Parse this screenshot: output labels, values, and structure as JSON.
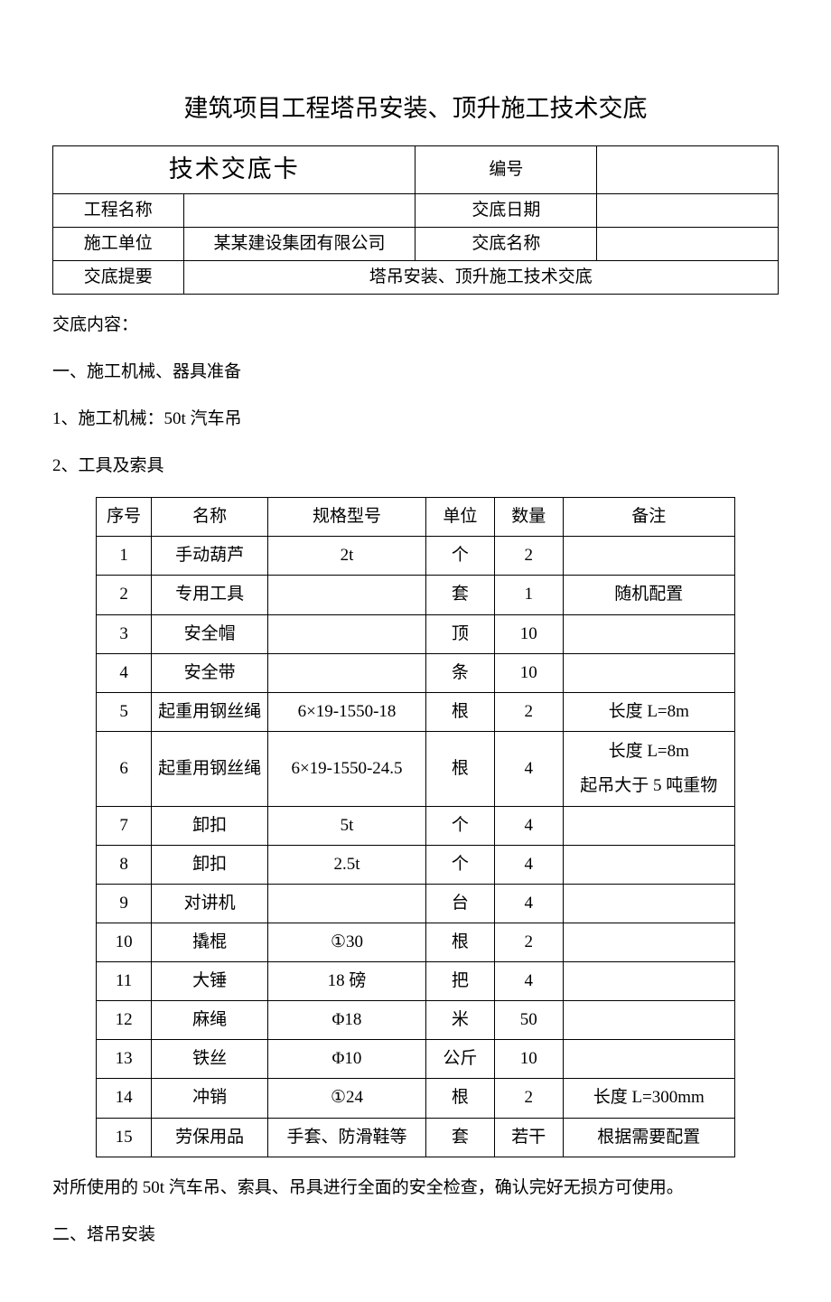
{
  "title": "建筑项目工程塔吊安装、顶升施工技术交底",
  "info": {
    "card_title": "技术交底卡",
    "bianhao_label": "编号",
    "bianhao_value": "",
    "project_name_label": "工程名称",
    "project_name_value": "",
    "date_label": "交底日期",
    "date_value": "",
    "unit_label": "施工单位",
    "unit_value": "某某建设集团有限公司",
    "topic_name_label": "交底名称",
    "topic_name_value": "",
    "summary_label": "交底提要",
    "summary_value": "塔吊安装、顶升施工技术交底"
  },
  "body": {
    "content_label": "交底内容：",
    "s1_title": "一、施工机械、器具准备",
    "s1_1": "1、施工机械：50t 汽车吊",
    "s1_2": "2、工具及索具",
    "after_table": "对所使用的 50t 汽车吊、索具、吊具进行全面的安全检查，确认完好无损方可使用。",
    "s2_title": "二、塔吊安装"
  },
  "tools_header": {
    "idx": "序号",
    "name": "名称",
    "spec": "规格型号",
    "unit": "单位",
    "qty": "数量",
    "note": "备注"
  },
  "tools": [
    {
      "idx": "1",
      "name": "手动葫芦",
      "spec": "2t",
      "unit": "个",
      "qty": "2",
      "note": ""
    },
    {
      "idx": "2",
      "name": "专用工具",
      "spec": "",
      "unit": "套",
      "qty": "1",
      "note": "随机配置"
    },
    {
      "idx": "3",
      "name": "安全帽",
      "spec": "",
      "unit": "顶",
      "qty": "10",
      "note": ""
    },
    {
      "idx": "4",
      "name": "安全带",
      "spec": "",
      "unit": "条",
      "qty": "10",
      "note": ""
    },
    {
      "idx": "5",
      "name": "起重用钢丝绳",
      "spec": "6×19-1550-18",
      "unit": "根",
      "qty": "2",
      "note": "长度 L=8m"
    },
    {
      "idx": "6",
      "name": "起重用钢丝绳",
      "spec": "6×19-1550-24.5",
      "unit": "根",
      "qty": "4",
      "note": "长度 L=8m\n起吊大于 5 吨重物"
    },
    {
      "idx": "7",
      "name": "卸扣",
      "spec": "5t",
      "unit": "个",
      "qty": "4",
      "note": ""
    },
    {
      "idx": "8",
      "name": "卸扣",
      "spec": "2.5t",
      "unit": "个",
      "qty": "4",
      "note": ""
    },
    {
      "idx": "9",
      "name": "对讲机",
      "spec": "",
      "unit": "台",
      "qty": "4",
      "note": ""
    },
    {
      "idx": "10",
      "name": "撬棍",
      "spec": "①30",
      "unit": "根",
      "qty": "2",
      "note": ""
    },
    {
      "idx": "11",
      "name": "大锤",
      "spec": "18 磅",
      "unit": "把",
      "qty": "4",
      "note": ""
    },
    {
      "idx": "12",
      "name": "麻绳",
      "spec": "Φ18",
      "unit": "米",
      "qty": "50",
      "note": ""
    },
    {
      "idx": "13",
      "name": "铁丝",
      "spec": "Φ10",
      "unit": "公斤",
      "qty": "10",
      "note": ""
    },
    {
      "idx": "14",
      "name": "冲销",
      "spec": "①24",
      "unit": "根",
      "qty": "2",
      "note": "长度 L=300mm"
    },
    {
      "idx": "15",
      "name": "劳保用品",
      "spec": "手套、防滑鞋等",
      "unit": "套",
      "qty": "若干",
      "note": "根据需要配置"
    }
  ]
}
